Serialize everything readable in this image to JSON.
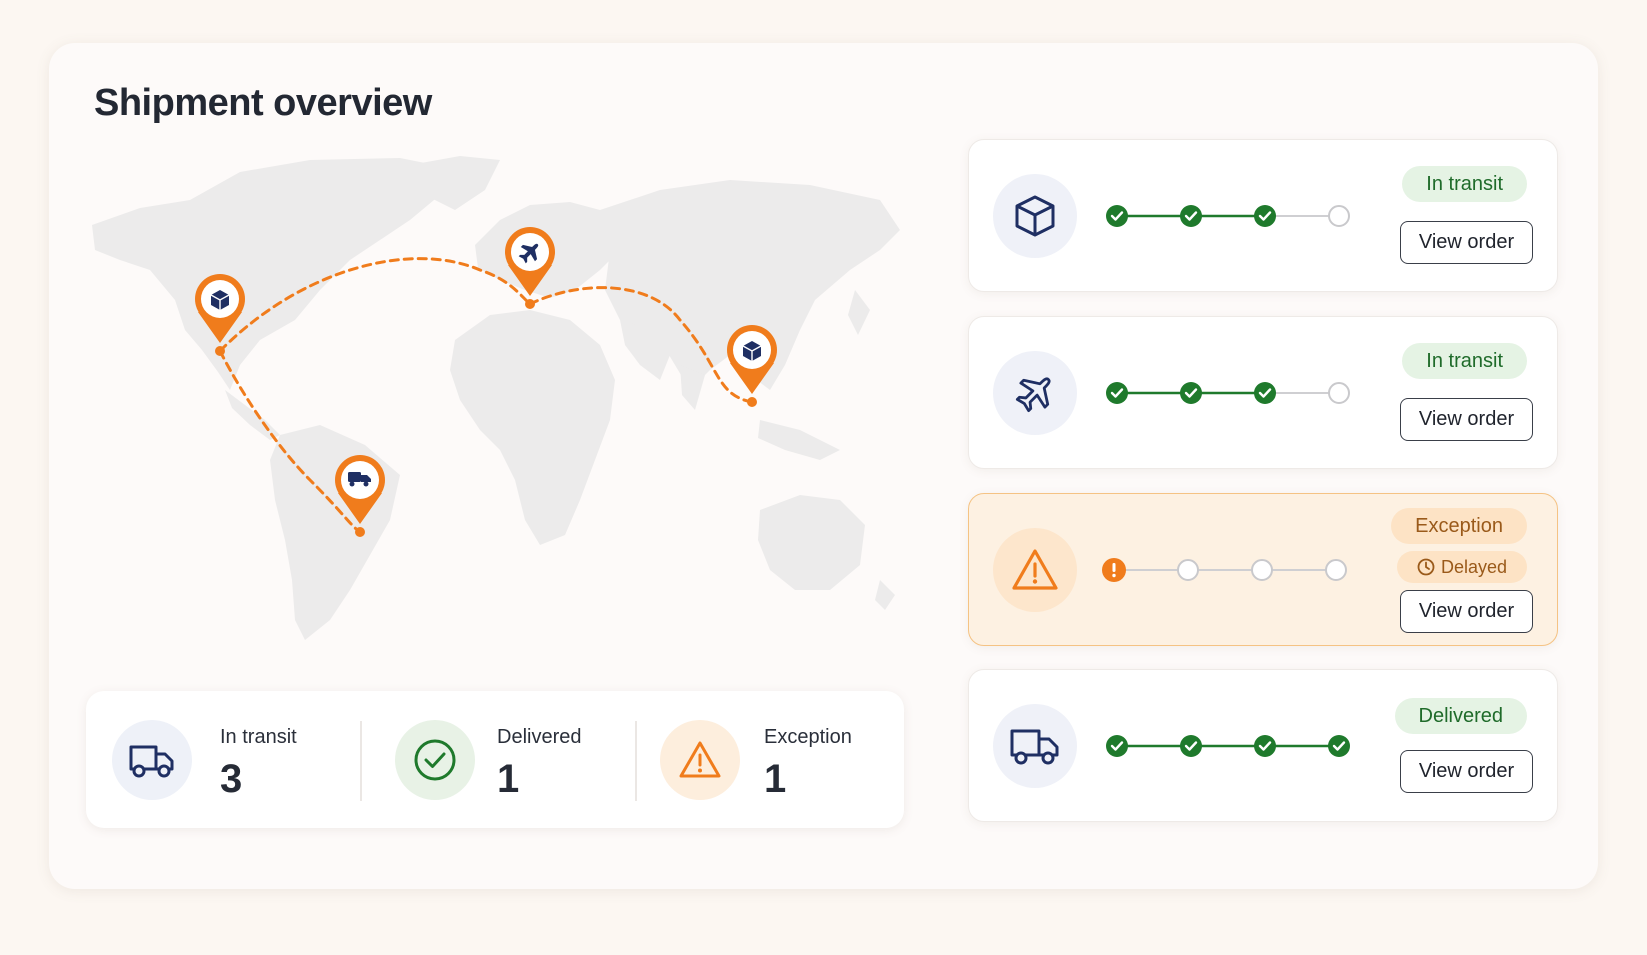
{
  "title": "Shipment overview",
  "colors": {
    "accent": "#f07c1c",
    "navy": "#1f2f63",
    "success": "#1f7a2c",
    "map_land": "#eceaea"
  },
  "map": {
    "pins": [
      {
        "name": "north-america",
        "icon": "package-icon"
      },
      {
        "name": "europe",
        "icon": "airplane-icon"
      },
      {
        "name": "east-asia",
        "icon": "package-icon"
      },
      {
        "name": "south-america",
        "icon": "truck-icon"
      }
    ]
  },
  "summary": {
    "in_transit": {
      "label": "In transit",
      "value": "3",
      "icon": "truck-icon"
    },
    "delivered": {
      "label": "Delivered",
      "value": "1",
      "icon": "check-circle-icon"
    },
    "exception": {
      "label": "Exception",
      "value": "1",
      "icon": "warning-icon"
    }
  },
  "shipments": [
    {
      "icon": "package-icon",
      "status": "In transit",
      "button": "View order",
      "steps": [
        "done",
        "done",
        "done",
        "pending"
      ]
    },
    {
      "icon": "airplane-icon",
      "status": "In transit",
      "button": "View order",
      "steps": [
        "done",
        "done",
        "done",
        "pending"
      ]
    },
    {
      "icon": "warning-icon",
      "status": "Exception",
      "substatus": "Delayed",
      "button": "View order",
      "steps": [
        "error",
        "pending",
        "pending",
        "pending"
      ]
    },
    {
      "icon": "truck-icon",
      "status": "Delivered",
      "button": "View order",
      "steps": [
        "done",
        "done",
        "done",
        "done"
      ]
    }
  ]
}
